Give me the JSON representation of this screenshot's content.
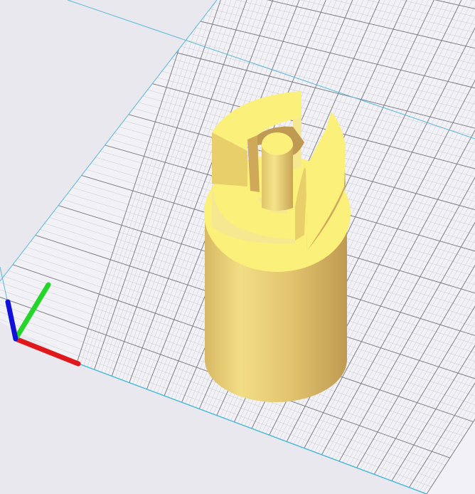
{
  "viewport": {
    "background": "#e9e8ef",
    "plate_color": "#f2f2f6",
    "grid_minor_color": "#c8c8d0",
    "grid_major_color": "#7f7f88",
    "plate_edge_color": "#39b7d9",
    "volume_edge_color": "#5ab8d8"
  },
  "model": {
    "colors": {
      "top_face": "#fbf07a",
      "light_side": "#f5e890",
      "mid_side": "#e8cf6a",
      "dark_side": "#cfa85a",
      "shadow_side": "#bf9a52"
    }
  },
  "axes": {
    "x_color": "#e0171b",
    "y_color": "#24d62a",
    "z_color": "#1010d8",
    "icons": [
      "x-axis-icon",
      "y-axis-icon",
      "z-axis-icon"
    ]
  }
}
